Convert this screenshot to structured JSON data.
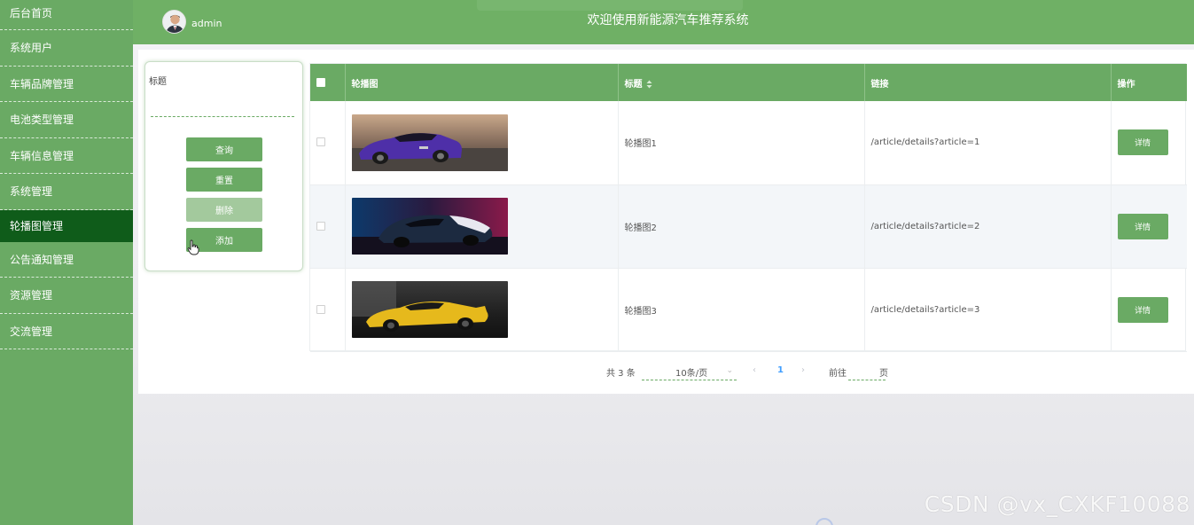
{
  "sidebar": {
    "items": [
      {
        "label": "后台首页"
      },
      {
        "label": "系统用户"
      },
      {
        "label": "车辆品牌管理"
      },
      {
        "label": "电池类型管理"
      },
      {
        "label": "车辆信息管理"
      },
      {
        "label": "系统管理"
      },
      {
        "label": "轮播图管理",
        "active": true
      },
      {
        "label": "公告通知管理"
      },
      {
        "label": "资源管理"
      },
      {
        "label": "交流管理"
      }
    ]
  },
  "header": {
    "username": "admin",
    "title": "欢迎使用新能源汽车推荐系统",
    "avatar_icon": "user-avatar-icon"
  },
  "search": {
    "label": "标题",
    "value": "",
    "placeholder": "",
    "buttons": {
      "query": "查询",
      "reset": "重置",
      "delete": "删除",
      "add": "添加"
    }
  },
  "table": {
    "columns": {
      "image": "轮播图",
      "title": "标题",
      "link": "链接",
      "action": "操作"
    },
    "rows": [
      {
        "title": "轮播图1",
        "link": "/article/details?article=1",
        "action": "详情",
        "image_desc": "purple sports car"
      },
      {
        "title": "轮播图2",
        "link": "/article/details?article=2",
        "action": "详情",
        "image_desc": "dark concept car neon"
      },
      {
        "title": "轮播图3",
        "link": "/article/details?article=3",
        "action": "详情",
        "image_desc": "yellow race car"
      }
    ]
  },
  "pagination": {
    "total": "共 3 条",
    "page_size": "10条/页",
    "current_page": "1",
    "goto_label": "前往",
    "page_suffix": "页",
    "goto_value": ""
  },
  "watermark": "CSDN @vx_CXKF10088",
  "colors": {
    "primary": "#6aaa64",
    "sidebar_active": "#0f5c1a",
    "pager_active": "#409eff"
  }
}
